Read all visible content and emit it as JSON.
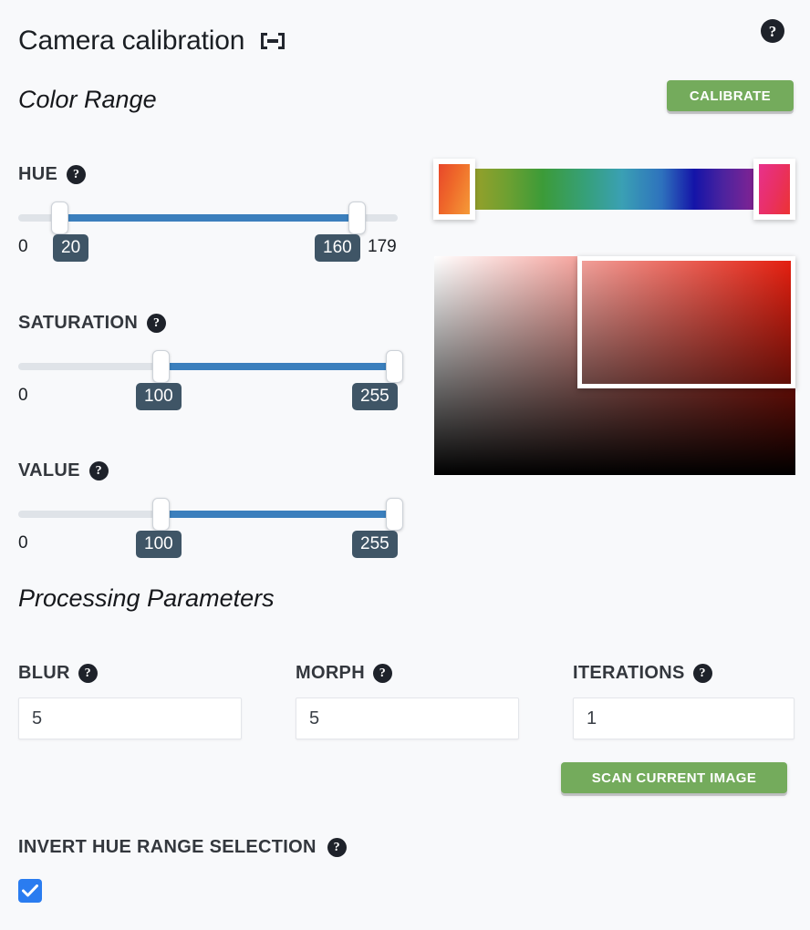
{
  "header": {
    "title": "Camera calibration",
    "collapse_icon": "collapse-icon",
    "help_icon": "help-icon"
  },
  "sections": {
    "color_range": "Color Range",
    "processing_parameters": "Processing Parameters"
  },
  "buttons": {
    "calibrate": "CALIBRATE",
    "scan_current_image": "SCAN CURRENT IMAGE"
  },
  "colors": {
    "accent_green": "#74ab5c",
    "slider_fill": "#3b7fbd",
    "slider_track": "#dfe3e8",
    "bubble_bg": "#3f5566",
    "checkbox_blue": "#2a7cf0",
    "help_icon_bg": "#1e222a",
    "page_bg": "#f8f9fb"
  },
  "sliders": [
    {
      "name": "hue",
      "label": "HUE",
      "min_label": "0",
      "max_label": "179",
      "low_value": "20",
      "high_value": "160",
      "min": 0,
      "max": 179
    },
    {
      "name": "saturation",
      "label": "SATURATION",
      "min_label": "0",
      "max_label": "255",
      "low_value": "100",
      "high_value": "255",
      "min": 0,
      "max": 255
    },
    {
      "name": "value",
      "label": "VALUE",
      "min_label": "0",
      "max_label": "255",
      "low_value": "100",
      "high_value": "255",
      "min": 0,
      "max": 255
    }
  ],
  "preview": {
    "hue_strip_name": "hue-gradient-strip",
    "left_swatch_name": "hue-range-start-swatch",
    "right_swatch_name": "hue-range-end-swatch",
    "sv_picker_name": "saturation-value-picker",
    "sv_selection_name": "saturation-value-selection"
  },
  "fields": [
    {
      "name": "blur",
      "label": "BLUR",
      "value": "5"
    },
    {
      "name": "morph",
      "label": "MORPH",
      "value": "5"
    },
    {
      "name": "iterations",
      "label": "ITERATIONS",
      "value": "1"
    }
  ],
  "invert": {
    "label": "INVERT HUE RANGE SELECTION",
    "checked": true
  }
}
